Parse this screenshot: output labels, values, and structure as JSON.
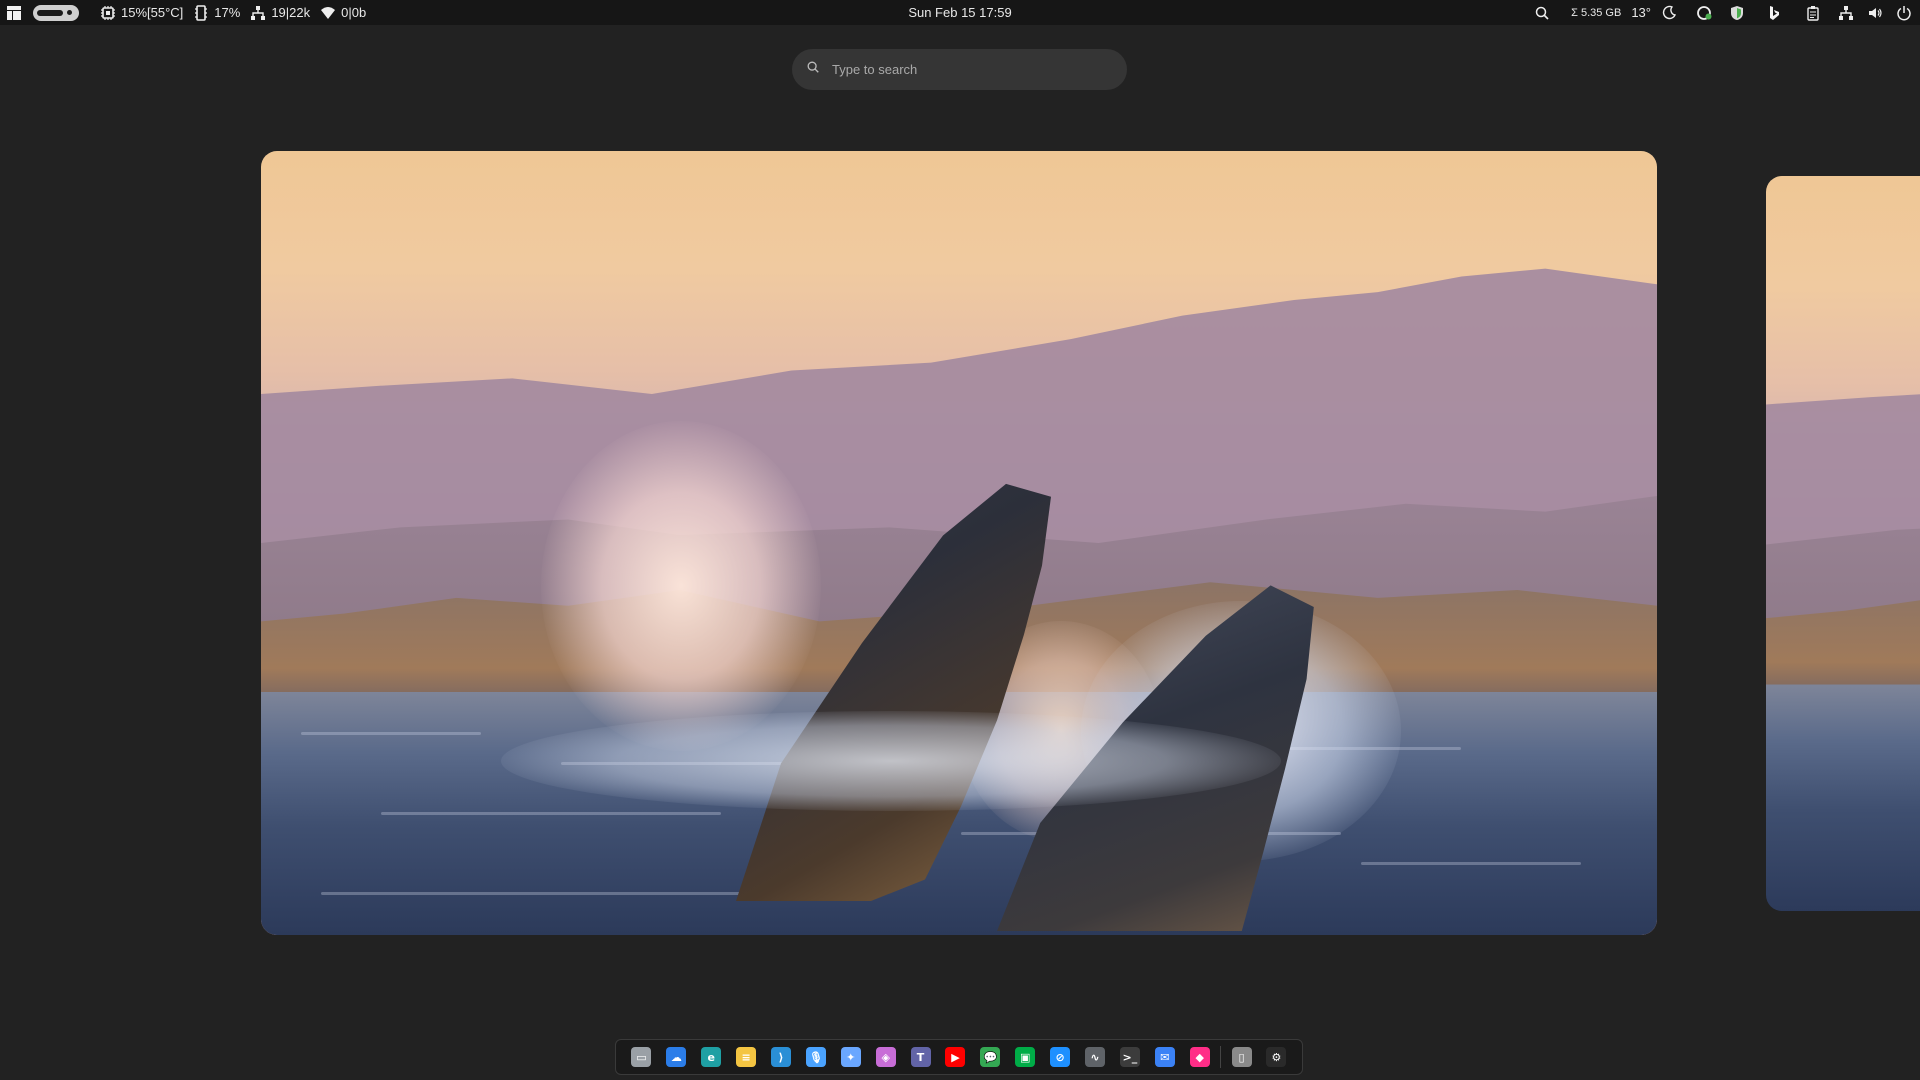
{
  "topbar": {
    "cpu": "15%[55°C]",
    "memory": "17%",
    "network_stats": "19|22k",
    "wifi_stats": "0|0b",
    "datetime": "Sun Feb 15  17:59",
    "storage": "Σ 5.35 GB",
    "temperature": "13°",
    "icons_left": [
      "layout-icon",
      "workspace-pill",
      "cpu-icon",
      "memory-icon",
      "network-icon",
      "wifi-icon"
    ],
    "icons_right": [
      "search-icon",
      "weather-icon",
      "refresh-icon",
      "shield-icon",
      "bing-icon",
      "clipboard-icon",
      "network-icon",
      "volume-icon",
      "power-icon"
    ]
  },
  "search": {
    "placeholder": "Type to search"
  },
  "dock": {
    "apps": [
      {
        "name": "files-icon",
        "color": "#9aa0a6",
        "glyph": "▭"
      },
      {
        "name": "onedrive-icon",
        "color": "#2b7de9",
        "glyph": "☁"
      },
      {
        "name": "edge-icon",
        "color": "#1fa0a4",
        "glyph": "e"
      },
      {
        "name": "notes-icon",
        "color": "#f4c542",
        "glyph": "≡"
      },
      {
        "name": "vscode-icon",
        "color": "#2a8fd6",
        "glyph": "⟩"
      },
      {
        "name": "voice-icon",
        "color": "#4aa3ff",
        "glyph": "🎙"
      },
      {
        "name": "gemini-icon",
        "color": "#6aa7ff",
        "glyph": "✦"
      },
      {
        "name": "copilot-icon",
        "color": "#c86dd7",
        "glyph": "◈"
      },
      {
        "name": "teams-icon",
        "color": "#6264a7",
        "glyph": "T"
      },
      {
        "name": "youtube-icon",
        "color": "#ff0000",
        "glyph": "▶"
      },
      {
        "name": "chat-icon",
        "color": "#34a853",
        "glyph": "💬"
      },
      {
        "name": "meet-icon",
        "color": "#00ac47",
        "glyph": "▣"
      },
      {
        "name": "safari-icon",
        "color": "#1e90ff",
        "glyph": "⊘"
      },
      {
        "name": "monitor-icon",
        "color": "#5f6368",
        "glyph": "∿"
      },
      {
        "name": "terminal-icon",
        "color": "#3c3c3c",
        "glyph": ">_"
      },
      {
        "name": "messenger-icon",
        "color": "#3b82f6",
        "glyph": "✉"
      },
      {
        "name": "app-icon",
        "color": "#ff2d87",
        "glyph": "◆"
      },
      {
        "name": "trash-icon",
        "color": "#8a8a8a",
        "glyph": "▯"
      },
      {
        "name": "settings-icon",
        "color": "#2a2a2a",
        "glyph": "⚙"
      }
    ]
  },
  "colors": {
    "background": "#222222",
    "topbar": "#161616",
    "search_bg": "#353535"
  }
}
